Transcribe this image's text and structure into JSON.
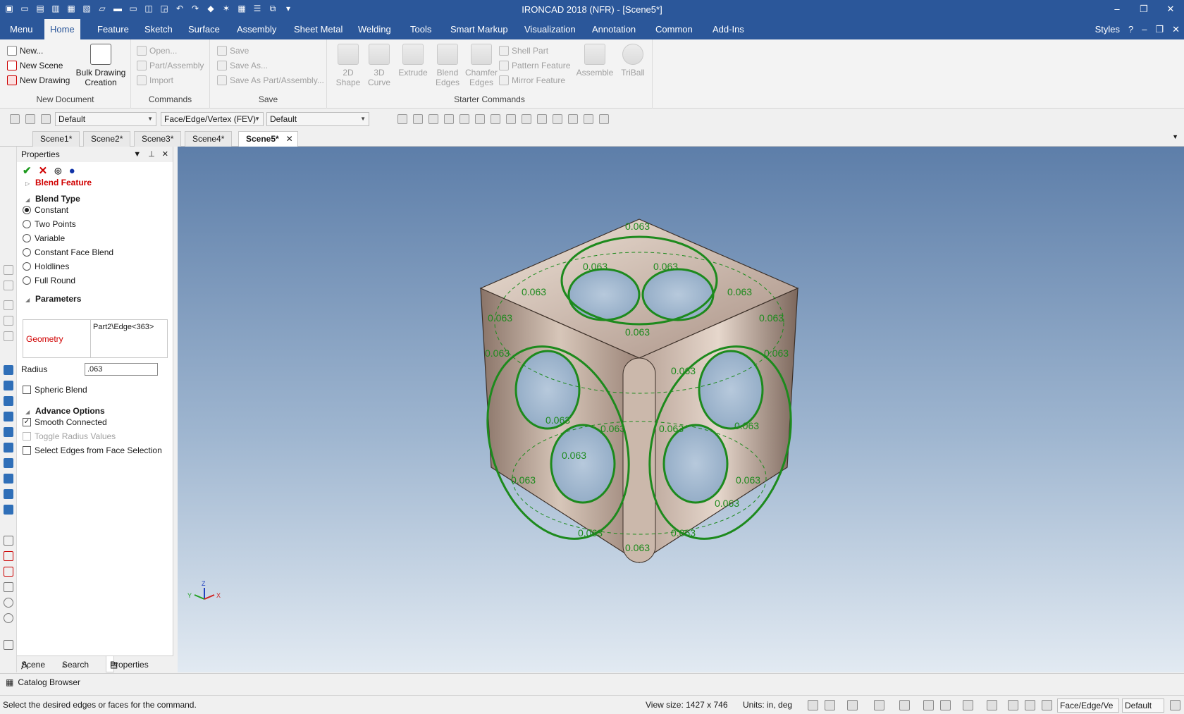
{
  "window": {
    "title": "IRONCAD 2018 (NFR) - [Scene5*]",
    "controls": [
      "–",
      "❐",
      "✕"
    ]
  },
  "ribbon_tabs": [
    "Menu",
    "Home",
    "Feature",
    "Sketch",
    "Surface",
    "Assembly",
    "Sheet Metal",
    "Welding",
    "Tools",
    "Smart Markup",
    "Visualization",
    "Annotation",
    "Common",
    "Add-Ins"
  ],
  "active_tab": "Home",
  "ribbon_right": {
    "styles": "Styles",
    "help": "?"
  },
  "groups": {
    "new_document": {
      "label": "New Document",
      "new": "New...",
      "new_scene": "New Scene",
      "new_drawing": "New Drawing",
      "bulk_1": "Bulk Drawing",
      "bulk_2": "Creation"
    },
    "commands": {
      "label": "Commands",
      "open": "Open...",
      "part_assembly": "Part/Assembly",
      "import": "Import"
    },
    "save": {
      "label": "Save",
      "save": "Save",
      "save_as": "Save As...",
      "save_as_part": "Save As Part/Assembly..."
    },
    "starter": {
      "label": "Starter Commands",
      "shape_1": "2D",
      "shape_2": "Shape",
      "curve_1": "3D",
      "curve_2": "Curve",
      "extrude": "Extrude",
      "blend_1": "Blend",
      "blend_2": "Edges",
      "chamfer_1": "Chamfer",
      "chamfer_2": "Edges",
      "shell": "Shell Part",
      "pattern": "Pattern Feature",
      "mirror": "Mirror Feature",
      "assemble": "Assemble",
      "triball": "TriBall"
    }
  },
  "toolstrip": {
    "combo1": "Default",
    "combo2": "Face/Edge/Vertex (FEV)",
    "combo3": "Default"
  },
  "doc_tabs": [
    "Scene1*",
    "Scene2*",
    "Scene3*",
    "Scene4*",
    "Scene5*"
  ],
  "active_doc": "Scene5*",
  "properties": {
    "title": "Properties",
    "feature": "Blend Feature",
    "blend_type_label": "Blend Type",
    "blend_types": [
      "Constant",
      "Two Points",
      "Variable",
      "Constant Face Blend",
      "Holdlines",
      "Full Round"
    ],
    "selected_type": "Constant",
    "parameters_label": "Parameters",
    "geometry_label": "Geometry",
    "geometry_value": "Part2\\Edge<363>",
    "radius_label": "Radius",
    "radius_value": ".063",
    "spheric_blend": "Spheric Blend",
    "advance_label": "Advance Options",
    "smooth_connected": "Smooth Connected",
    "toggle_radius": "Toggle Radius Values",
    "select_edges": "Select Edges from Face Selection",
    "bottom_tabs": {
      "scene": "Scene",
      "search": "Search",
      "properties": "Properties"
    }
  },
  "viewport": {
    "blend_label": "0.063",
    "triad": {
      "z": "Z",
      "y": "Y",
      "x": "X"
    }
  },
  "catalog": "Catalog Browser",
  "status": {
    "message": "Select the desired edges or faces for the command.",
    "view_size": "View size: 1427 x  746",
    "units": "Units: in, deg",
    "combo1": "Face/Edge/Ve",
    "combo2": "Default"
  },
  "colors": {
    "accent": "#2b579a",
    "blend_highlight": "#1d8a1d",
    "feature_title": "#d00000"
  }
}
